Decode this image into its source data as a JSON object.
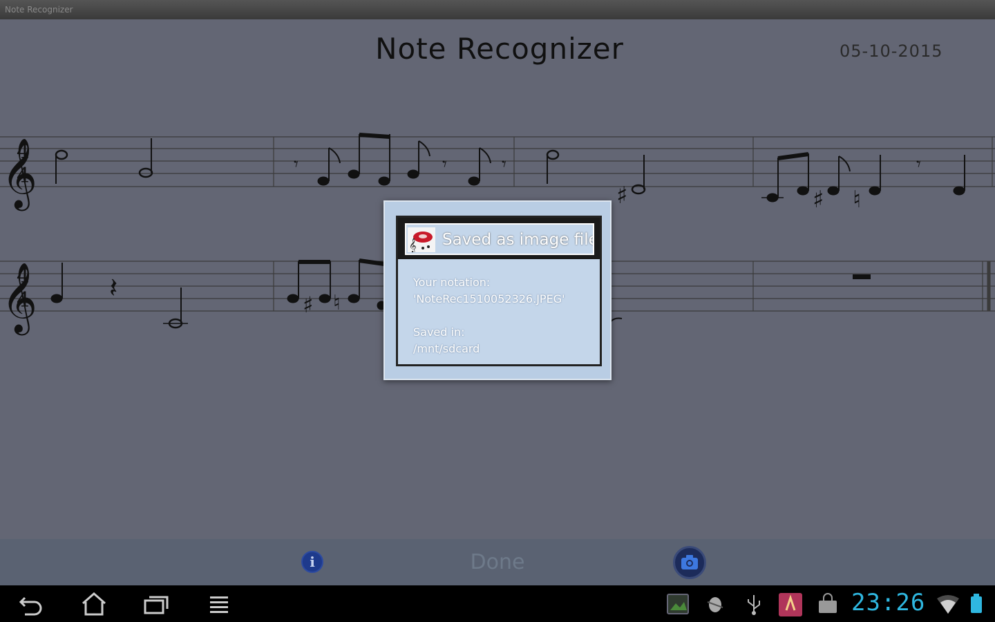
{
  "window": {
    "title": "Note Recognizer"
  },
  "header": {
    "title": "Note Recognizer",
    "date": "05-10-2015"
  },
  "dialog": {
    "title": "Saved as image file",
    "notation_label": "Your notation:",
    "notation_value": "'NoteRec1510052326.JPEG'",
    "saved_label": "Saved in:",
    "saved_value": "/mnt/sdcard"
  },
  "bottom_bar": {
    "done_label": "Done",
    "info_icon": "info-icon",
    "camera_icon": "camera-icon"
  },
  "system_bar": {
    "time": "23:26",
    "nav_icons": [
      "back-icon",
      "home-icon",
      "recent-apps-icon",
      "menu-icon"
    ],
    "status_icons": [
      "gallery-notification-icon",
      "android-debug-icon",
      "usb-icon",
      "app-notification-icon",
      "store-icon",
      "wifi-icon",
      "battery-icon"
    ]
  },
  "colors": {
    "clock": "#2fb7e0",
    "dialog_bg": "#c4d6ea",
    "info_button": "#1e3a8c"
  }
}
